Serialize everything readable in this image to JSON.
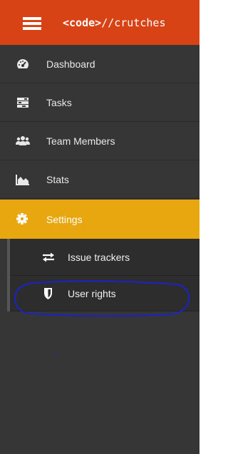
{
  "header": {
    "brand_tag": "<code>",
    "brand_rest": "//crutches"
  },
  "nav": {
    "items": [
      {
        "label": "Dashboard",
        "icon": "dashboard-gauge-icon"
      },
      {
        "label": "Tasks",
        "icon": "tasks-icon"
      },
      {
        "label": "Team Members",
        "icon": "team-members-icon"
      },
      {
        "label": "Stats",
        "icon": "area-chart-icon"
      },
      {
        "label": "Settings",
        "icon": "gear-icon",
        "active": true
      }
    ],
    "submenu": [
      {
        "label": "Issue trackers",
        "icon": "exchange-arrows-icon"
      },
      {
        "label": "User rights",
        "icon": "shield-icon"
      }
    ]
  },
  "colors": {
    "header": "#d84315",
    "sidebar": "#363636",
    "active": "#e8a60f",
    "annotation": "#1a23c8"
  }
}
